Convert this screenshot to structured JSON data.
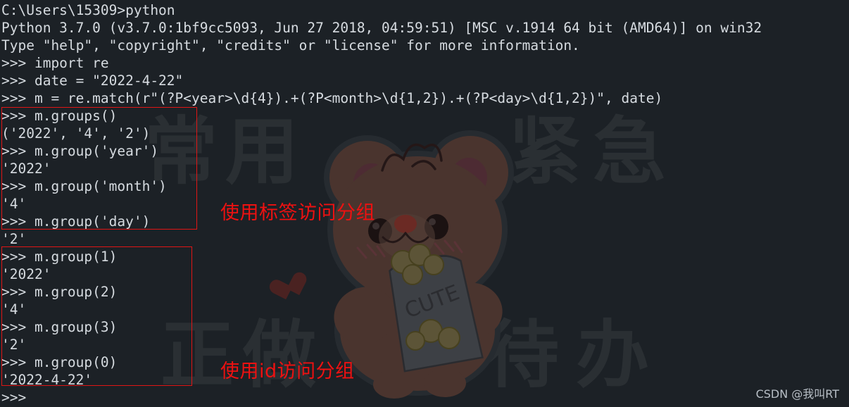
{
  "window": {
    "title": "Windows Command Prompt - python",
    "background_color": "#1c2126",
    "text_color": "#d6dbe0",
    "annotation_color": "#ee1111"
  },
  "terminal": {
    "lines": [
      {
        "id": "line-01",
        "text": "C:\\Users\\15309>python"
      },
      {
        "id": "line-02",
        "text": "Python 3.7.0 (v3.7.0:1bf9cc5093, Jun 27 2018, 04:59:51) [MSC v.1914 64 bit (AMD64)] on win32"
      },
      {
        "id": "line-03",
        "text": "Type \"help\", \"copyright\", \"credits\" or \"license\" for more information."
      },
      {
        "id": "line-04",
        "text": ">>> import re"
      },
      {
        "id": "line-05",
        "text": ">>> date = \"2022-4-22\""
      },
      {
        "id": "line-06",
        "text": ">>> m = re.match(r\"(?P<year>\\d{4}).+(?P<month>\\d{1,2}).+(?P<day>\\d{1,2})\", date)"
      },
      {
        "id": "line-07",
        "text": ">>> m.groups()"
      },
      {
        "id": "line-08",
        "text": "('2022', '4', '2')"
      },
      {
        "id": "line-09",
        "text": ">>> m.group('year')"
      },
      {
        "id": "line-10",
        "text": "'2022'"
      },
      {
        "id": "line-11",
        "text": ">>> m.group('month')"
      },
      {
        "id": "line-12",
        "text": "'4'"
      },
      {
        "id": "line-13",
        "text": ">>> m.group('day')"
      },
      {
        "id": "line-14",
        "text": "'2'"
      },
      {
        "id": "line-15",
        "text": ">>> m.group(1)"
      },
      {
        "id": "line-16",
        "text": "'2022'"
      },
      {
        "id": "line-17",
        "text": ">>> m.group(2)"
      },
      {
        "id": "line-18",
        "text": "'4'"
      },
      {
        "id": "line-19",
        "text": ">>> m.group(3)"
      },
      {
        "id": "line-20",
        "text": "'2'"
      },
      {
        "id": "line-21",
        "text": ">>> m.group(0)"
      },
      {
        "id": "line-22",
        "text": "'2022-4-22'"
      },
      {
        "id": "line-23",
        "text": ">>>"
      }
    ]
  },
  "annotations": {
    "label_access": "使用标签访问分组",
    "id_access": "使用id访问分组"
  },
  "watermark": {
    "text": "CSDN @我叫RT"
  },
  "background_art": {
    "characters": [
      "常",
      "用",
      "紧",
      "急",
      "正",
      "做",
      "待",
      "办"
    ],
    "sticker": "teddy-bear-holding-cute-snack-bag",
    "sticker_label": "CUTE"
  }
}
